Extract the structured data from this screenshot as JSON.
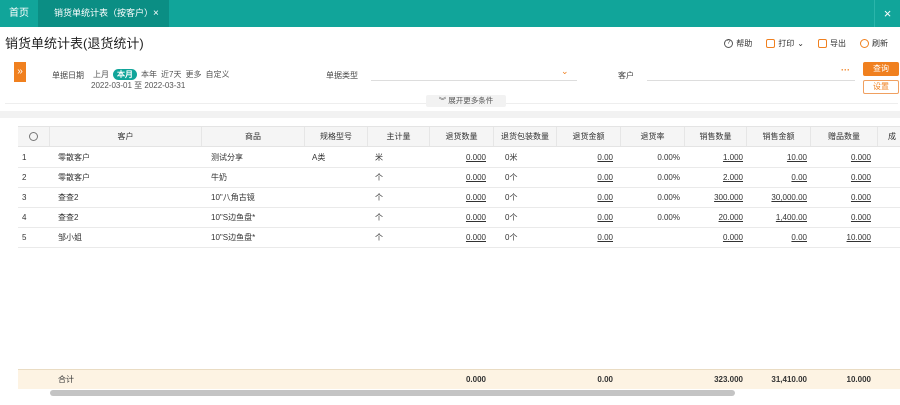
{
  "tabs": {
    "home": "首页",
    "active": "销货单统计表（按客户）",
    "close": "×",
    "window_close": "×"
  },
  "page": {
    "title": "销货单统计表(退货统计)"
  },
  "toolbar": {
    "help": "帮助",
    "print": "打印",
    "export": "导出",
    "refresh": "刷新"
  },
  "filter": {
    "toggle": "»",
    "date_label": "单据日期",
    "date_options": [
      "上月",
      "本月",
      "本年",
      "近7天",
      "更多",
      "自定义"
    ],
    "date_active": "本月",
    "date_from": "2022-03-01",
    "date_to_word": "至",
    "date_to": "2022-03-31",
    "type_label": "单据类型",
    "customer_label": "客户",
    "customer_more": "···",
    "query": "查询",
    "settings": "设置",
    "more_conditions": "展开更多条件"
  },
  "table": {
    "columns": [
      "",
      "客户",
      "商品",
      "规格型号",
      "主计量",
      "退货数量",
      "退货包装数量",
      "退货金额",
      "退货率",
      "销售数量",
      "销售金额",
      "赠品数量",
      "成"
    ],
    "rows": [
      [
        "1",
        "零散客户",
        "测试分享",
        "A类",
        "米",
        "0.000",
        "0米",
        "0.00",
        "0.00%",
        "1.000",
        "10.00",
        "0.000"
      ],
      [
        "2",
        "零散客户",
        "牛奶",
        "",
        "个",
        "0.000",
        "0个",
        "0.00",
        "0.00%",
        "2.000",
        "0.00",
        "0.000"
      ],
      [
        "3",
        "查查2",
        "10\"八角古镜",
        "",
        "个",
        "0.000",
        "0个",
        "0.00",
        "0.00%",
        "300.000",
        "30,000.00",
        "0.000"
      ],
      [
        "4",
        "查查2",
        "10\"S边鱼盘*",
        "",
        "个",
        "0.000",
        "0个",
        "0.00",
        "0.00%",
        "20.000",
        "1,400.00",
        "0.000"
      ],
      [
        "5",
        "邹小姐",
        "10\"S边鱼盘*",
        "",
        "个",
        "0.000",
        "0个",
        "0.00",
        "",
        "0.000",
        "0.00",
        "10.000"
      ]
    ],
    "footer": {
      "label": "合计",
      "return_qty": "0.000",
      "return_amount": "0.00",
      "sales_qty": "323.000",
      "sales_amount": "31,410.00",
      "gift_qty": "10.000"
    }
  },
  "colors": {
    "primary": "#11a59a",
    "accent": "#f0801f"
  }
}
